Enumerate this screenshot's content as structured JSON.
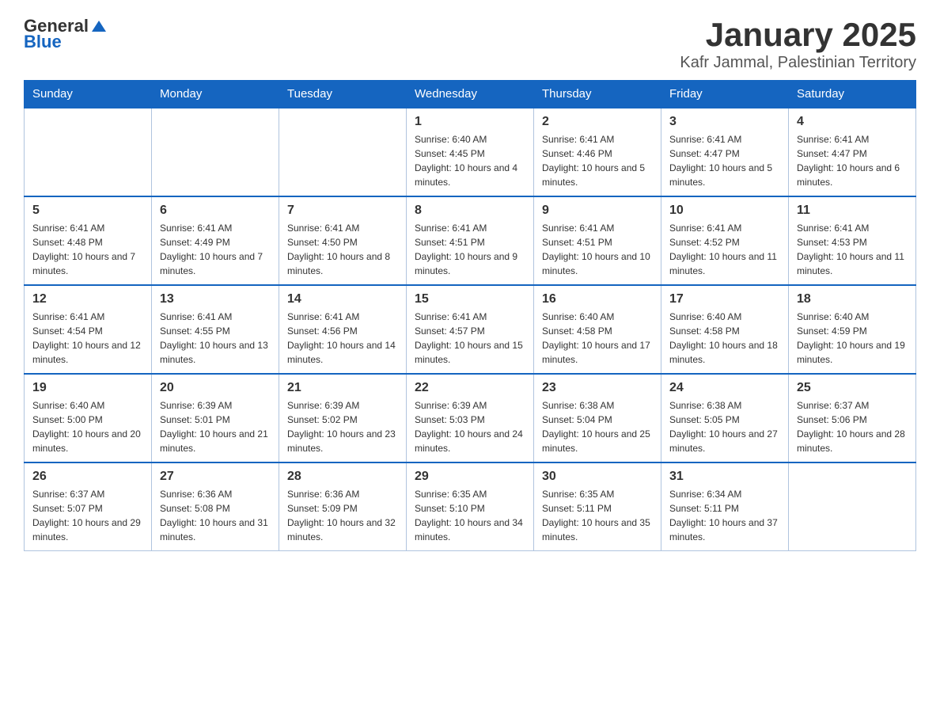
{
  "header": {
    "logo_general": "General",
    "logo_blue": "Blue",
    "title": "January 2025",
    "subtitle": "Kafr Jammal, Palestinian Territory"
  },
  "weekdays": [
    "Sunday",
    "Monday",
    "Tuesday",
    "Wednesday",
    "Thursday",
    "Friday",
    "Saturday"
  ],
  "weeks": [
    [
      {
        "day": "",
        "info": ""
      },
      {
        "day": "",
        "info": ""
      },
      {
        "day": "",
        "info": ""
      },
      {
        "day": "1",
        "info": "Sunrise: 6:40 AM\nSunset: 4:45 PM\nDaylight: 10 hours and 4 minutes."
      },
      {
        "day": "2",
        "info": "Sunrise: 6:41 AM\nSunset: 4:46 PM\nDaylight: 10 hours and 5 minutes."
      },
      {
        "day": "3",
        "info": "Sunrise: 6:41 AM\nSunset: 4:47 PM\nDaylight: 10 hours and 5 minutes."
      },
      {
        "day": "4",
        "info": "Sunrise: 6:41 AM\nSunset: 4:47 PM\nDaylight: 10 hours and 6 minutes."
      }
    ],
    [
      {
        "day": "5",
        "info": "Sunrise: 6:41 AM\nSunset: 4:48 PM\nDaylight: 10 hours and 7 minutes."
      },
      {
        "day": "6",
        "info": "Sunrise: 6:41 AM\nSunset: 4:49 PM\nDaylight: 10 hours and 7 minutes."
      },
      {
        "day": "7",
        "info": "Sunrise: 6:41 AM\nSunset: 4:50 PM\nDaylight: 10 hours and 8 minutes."
      },
      {
        "day": "8",
        "info": "Sunrise: 6:41 AM\nSunset: 4:51 PM\nDaylight: 10 hours and 9 minutes."
      },
      {
        "day": "9",
        "info": "Sunrise: 6:41 AM\nSunset: 4:51 PM\nDaylight: 10 hours and 10 minutes."
      },
      {
        "day": "10",
        "info": "Sunrise: 6:41 AM\nSunset: 4:52 PM\nDaylight: 10 hours and 11 minutes."
      },
      {
        "day": "11",
        "info": "Sunrise: 6:41 AM\nSunset: 4:53 PM\nDaylight: 10 hours and 11 minutes."
      }
    ],
    [
      {
        "day": "12",
        "info": "Sunrise: 6:41 AM\nSunset: 4:54 PM\nDaylight: 10 hours and 12 minutes."
      },
      {
        "day": "13",
        "info": "Sunrise: 6:41 AM\nSunset: 4:55 PM\nDaylight: 10 hours and 13 minutes."
      },
      {
        "day": "14",
        "info": "Sunrise: 6:41 AM\nSunset: 4:56 PM\nDaylight: 10 hours and 14 minutes."
      },
      {
        "day": "15",
        "info": "Sunrise: 6:41 AM\nSunset: 4:57 PM\nDaylight: 10 hours and 15 minutes."
      },
      {
        "day": "16",
        "info": "Sunrise: 6:40 AM\nSunset: 4:58 PM\nDaylight: 10 hours and 17 minutes."
      },
      {
        "day": "17",
        "info": "Sunrise: 6:40 AM\nSunset: 4:58 PM\nDaylight: 10 hours and 18 minutes."
      },
      {
        "day": "18",
        "info": "Sunrise: 6:40 AM\nSunset: 4:59 PM\nDaylight: 10 hours and 19 minutes."
      }
    ],
    [
      {
        "day": "19",
        "info": "Sunrise: 6:40 AM\nSunset: 5:00 PM\nDaylight: 10 hours and 20 minutes."
      },
      {
        "day": "20",
        "info": "Sunrise: 6:39 AM\nSunset: 5:01 PM\nDaylight: 10 hours and 21 minutes."
      },
      {
        "day": "21",
        "info": "Sunrise: 6:39 AM\nSunset: 5:02 PM\nDaylight: 10 hours and 23 minutes."
      },
      {
        "day": "22",
        "info": "Sunrise: 6:39 AM\nSunset: 5:03 PM\nDaylight: 10 hours and 24 minutes."
      },
      {
        "day": "23",
        "info": "Sunrise: 6:38 AM\nSunset: 5:04 PM\nDaylight: 10 hours and 25 minutes."
      },
      {
        "day": "24",
        "info": "Sunrise: 6:38 AM\nSunset: 5:05 PM\nDaylight: 10 hours and 27 minutes."
      },
      {
        "day": "25",
        "info": "Sunrise: 6:37 AM\nSunset: 5:06 PM\nDaylight: 10 hours and 28 minutes."
      }
    ],
    [
      {
        "day": "26",
        "info": "Sunrise: 6:37 AM\nSunset: 5:07 PM\nDaylight: 10 hours and 29 minutes."
      },
      {
        "day": "27",
        "info": "Sunrise: 6:36 AM\nSunset: 5:08 PM\nDaylight: 10 hours and 31 minutes."
      },
      {
        "day": "28",
        "info": "Sunrise: 6:36 AM\nSunset: 5:09 PM\nDaylight: 10 hours and 32 minutes."
      },
      {
        "day": "29",
        "info": "Sunrise: 6:35 AM\nSunset: 5:10 PM\nDaylight: 10 hours and 34 minutes."
      },
      {
        "day": "30",
        "info": "Sunrise: 6:35 AM\nSunset: 5:11 PM\nDaylight: 10 hours and 35 minutes."
      },
      {
        "day": "31",
        "info": "Sunrise: 6:34 AM\nSunset: 5:11 PM\nDaylight: 10 hours and 37 minutes."
      },
      {
        "day": "",
        "info": ""
      }
    ]
  ]
}
